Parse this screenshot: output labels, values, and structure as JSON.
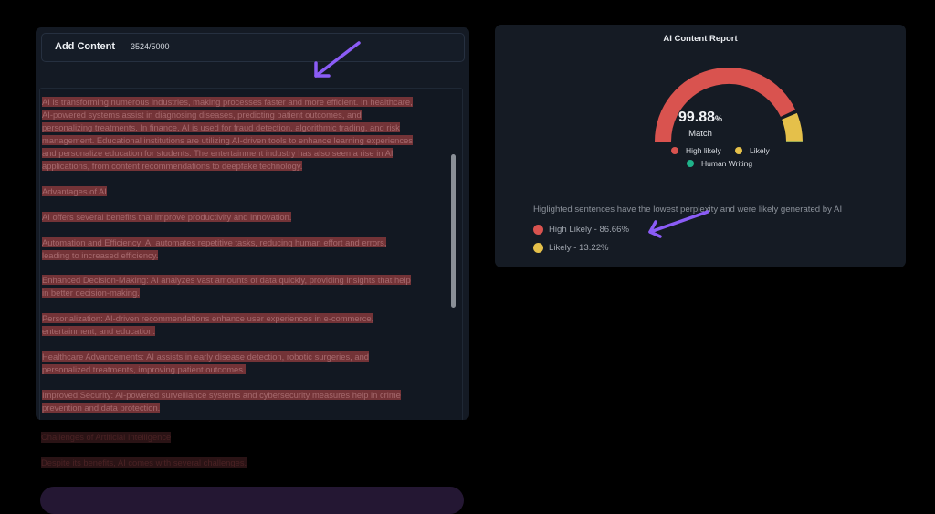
{
  "editor": {
    "title": "Add Content",
    "counter": "3524/5000",
    "paragraphs": [
      {
        "lines": [
          "AI is transforming numerous industries, making processes faster and more efficient. In healthcare,",
          "AI-powered systems assist in diagnosing diseases, predicting patient outcomes, and",
          "personalizing treatments. In finance, AI is used for fraud detection, algorithmic trading, and risk",
          "management. Educational institutions are utilizing AI-driven tools to enhance learning experiences",
          "and personalize education for students. The entertainment industry has also seen a rise in AI",
          "applications, from content recommendations to deepfake technology."
        ]
      },
      {
        "lines": [
          "Advantages of AI"
        ]
      },
      {
        "lines": [
          "AI offers several benefits that improve productivity and innovation."
        ]
      },
      {
        "lines": [
          "Automation and Efficiency: AI automates repetitive tasks, reducing human effort and errors,",
          "leading to increased efficiency."
        ]
      },
      {
        "lines": [
          "Enhanced Decision-Making: AI analyzes vast amounts of data quickly, providing insights that help",
          "in better decision-making."
        ]
      },
      {
        "lines": [
          "Personalization: AI-driven recommendations enhance user experiences in e-commerce,",
          "entertainment, and education."
        ]
      },
      {
        "lines": [
          "Healthcare Advancements: AI assists in early disease detection, robotic surgeries, and",
          "personalized treatments, improving patient outcomes."
        ]
      },
      {
        "lines": [
          "Improved Security: AI-powered surveillance systems and cybersecurity measures help in crime",
          "prevention and data protection."
        ]
      }
    ],
    "overflow_lines": [
      "Challenges of Artificial Intelligence",
      "Despite its benefits, AI comes with several challenges."
    ]
  },
  "report": {
    "title": "AI Content Report",
    "score": "99.88",
    "score_unit": "%",
    "match_label": "Match",
    "gauge": {
      "high_likely_pct": 86.66,
      "likely_pct": 13.22,
      "human_pct": 0.12
    },
    "legend": [
      {
        "label": "High likely",
        "color": "#d9534f"
      },
      {
        "label": "Likely",
        "color": "#e5c04a"
      },
      {
        "label": "Human Writing",
        "color": "#1fb38a"
      }
    ],
    "note": "Higlighted sentences have the lowest perplexity and were likely generated by AI",
    "stats": [
      {
        "label": "High Likely - 86.66%",
        "color": "#d9534f"
      },
      {
        "label": "Likely - 13.22%",
        "color": "#e5c04a"
      }
    ]
  },
  "colors": {
    "arrow": "#8b5cf6",
    "panel": "#141a24",
    "highlight": "#733337"
  }
}
